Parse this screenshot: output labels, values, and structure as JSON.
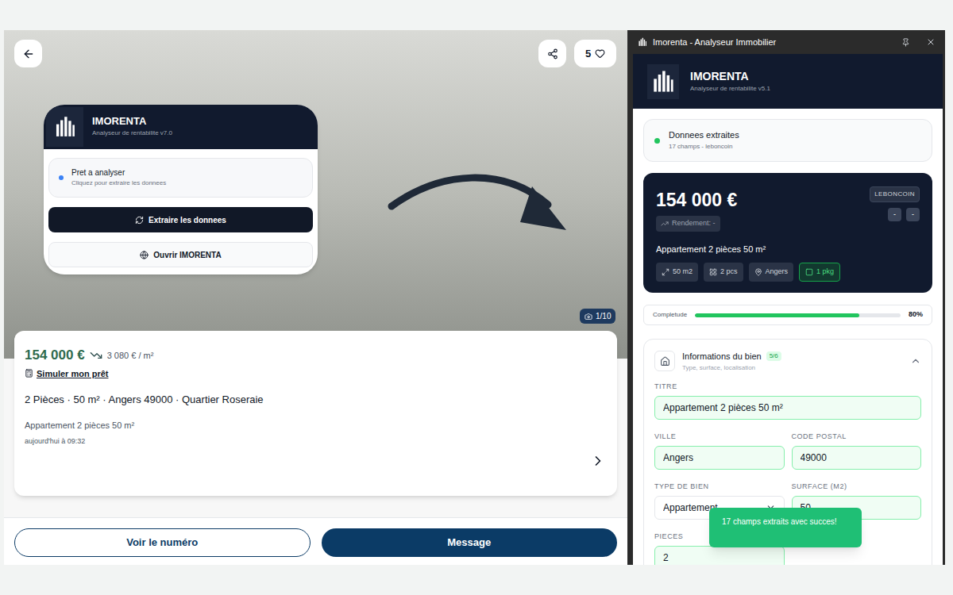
{
  "listing": {
    "photo_counter": "1/10",
    "likes": "5",
    "price": "154 000 €",
    "price_per_m2": "3 080 € / m²",
    "loan_link": "Simuler mon prêt",
    "summary": "2 Pièces · 50 m² · Angers 49000 · Quartier Roseraie",
    "title": "Appartement 2 pièces 50 m²",
    "date": "aujourd'hui à 09:32",
    "buttons": [
      {
        "label": "Voir le numéro",
        "primary": false
      },
      {
        "label": "Message",
        "primary": true
      }
    ]
  },
  "popup": {
    "brand": "IMORENTA",
    "version": "Analyseur de rentabilite v7.0",
    "status": {
      "title": "Pret a analyser",
      "subtitle": "Cliquez pour extraire les donnees",
      "color": "#3b82f6"
    },
    "buttons": [
      {
        "label": "Extraire les donnees",
        "primary": true
      },
      {
        "label": "Ouvrir IMORENTA",
        "primary": false
      }
    ]
  },
  "window": {
    "title": "Imorenta - Analyseur Immobilier"
  },
  "panel": {
    "brand": "IMORENTA",
    "version": "Analyseur de rentabilite v5.1",
    "status": {
      "title": "Donnees extraites",
      "subtitle": "17 champs - leboncoin",
      "color": "#22c55e"
    },
    "price_card": {
      "price": "154 000 €",
      "yield": "Rendement: -",
      "source": "LEBONCOIN",
      "actions": [
        "-",
        "-"
      ],
      "title": "Appartement 2 pièces 50 m²",
      "tags": [
        {
          "label": "50 m2",
          "highlighted": false
        },
        {
          "label": "2 pcs",
          "highlighted": false
        },
        {
          "label": "Angers",
          "highlighted": false
        },
        {
          "label": "1 pkg",
          "highlighted": true
        }
      ]
    },
    "completeness": {
      "label": "Completude",
      "level": 0.8,
      "reading": "80%"
    },
    "section": {
      "title": "Informations du bien",
      "badge": "5/6",
      "subtitle": "Type, surface, localisation",
      "expanded": true,
      "fields": [
        {
          "label": "TITRE",
          "value": "Appartement 2 pièces 50 m²",
          "kind": "text",
          "filled": true
        },
        {
          "label": "VILLE",
          "value": "Angers",
          "kind": "text",
          "filled": true
        },
        {
          "label": "CODE POSTAL",
          "value": "49000",
          "kind": "text",
          "filled": true
        },
        {
          "label": "TYPE DE BIEN",
          "value": "Appartement",
          "kind": "select",
          "filled": false
        },
        {
          "label": "SURFACE (M2)",
          "value": "50",
          "kind": "text",
          "filled": true
        },
        {
          "label": "PIECES",
          "value": "2",
          "kind": "text",
          "filled": true
        }
      ]
    }
  },
  "toast": {
    "message": "17 champs extraits avec succes!"
  }
}
